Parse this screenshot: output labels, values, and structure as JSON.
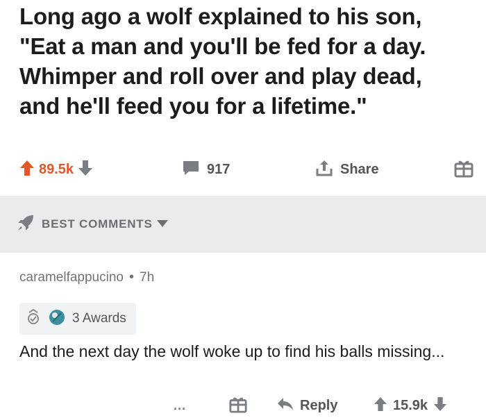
{
  "post": {
    "title": "Long ago a wolf explained to his son,\n\"Eat a man and you'll be fed for a day.\nWhimper and roll over and play dead,\nand he'll feed you for a lifetime.\"",
    "score": "89.5k",
    "comment_count": "917",
    "share_label": "Share"
  },
  "sort": {
    "label": "BEST COMMENTS"
  },
  "comment": {
    "author": "caramelfappucino",
    "separator": "•",
    "age": "7h",
    "awards_label": "3 Awards",
    "body": "And the next day the wolf woke up to find his balls missing...",
    "more_label": "...",
    "reply_label": "Reply",
    "score": "15.9k"
  },
  "colors": {
    "upvote": "#e4552a",
    "icon_gray": "#7a7e82",
    "sort_bar": "#e9ebed"
  },
  "icons": [
    "upvote-arrow-icon",
    "downvote-arrow-icon",
    "comment-bubble-icon",
    "share-icon",
    "gift-icon",
    "rocket-icon",
    "caret-down-icon",
    "reply-arrow-icon",
    "award-icon"
  ]
}
